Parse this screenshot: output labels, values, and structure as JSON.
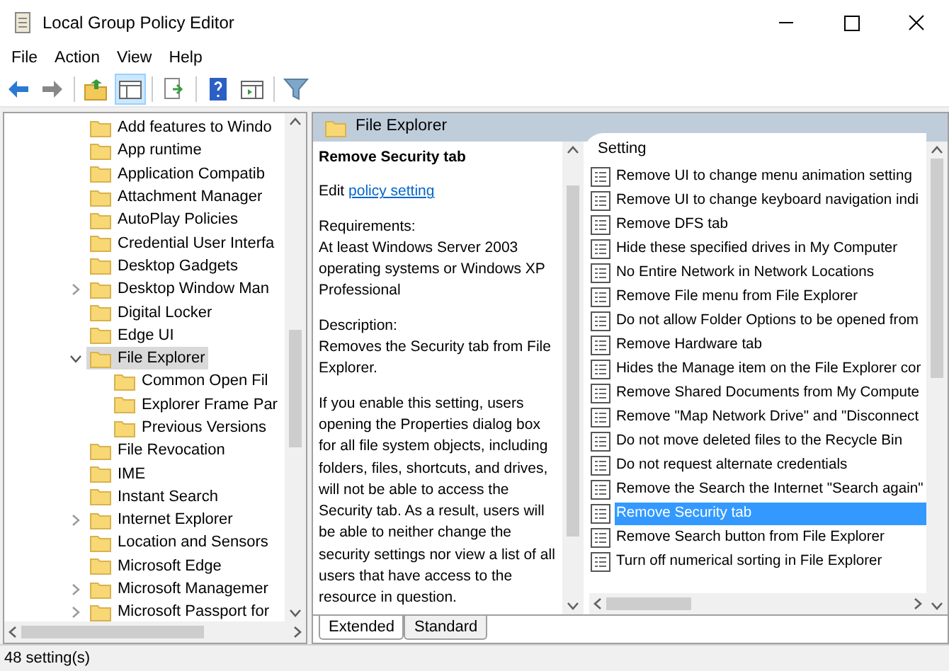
{
  "window": {
    "title": "Local Group Policy Editor"
  },
  "menu": [
    "File",
    "Action",
    "View",
    "Help"
  ],
  "toolbar": [
    {
      "kind": "back",
      "pressed": false
    },
    {
      "kind": "forward",
      "pressed": false
    },
    {
      "kind": "separator"
    },
    {
      "kind": "up",
      "pressed": false
    },
    {
      "kind": "tree",
      "pressed": true
    },
    {
      "kind": "separator"
    },
    {
      "kind": "export",
      "pressed": false
    },
    {
      "kind": "separator"
    },
    {
      "kind": "help",
      "pressed": false
    },
    {
      "kind": "view",
      "pressed": false
    },
    {
      "kind": "separator"
    },
    {
      "kind": "filter",
      "pressed": false
    }
  ],
  "tree": [
    {
      "label": "Add features to Windo",
      "selected": false
    },
    {
      "label": "App runtime",
      "selected": false
    },
    {
      "label": "Application Compatib",
      "selected": false
    },
    {
      "label": "Attachment Manager",
      "selected": false
    },
    {
      "label": "AutoPlay Policies",
      "selected": false
    },
    {
      "label": "Credential User Interfa",
      "selected": false
    },
    {
      "label": "Desktop Gadgets",
      "selected": false
    },
    {
      "label": "Desktop Window Man",
      "selected": false,
      "expanded": false
    },
    {
      "label": "Digital Locker",
      "selected": false
    },
    {
      "label": "Edge UI",
      "selected": false
    },
    {
      "label": "File Explorer",
      "selected": true,
      "expanded": true,
      "children": [
        {
          "label": "Common Open Fil",
          "selected": false
        },
        {
          "label": "Explorer Frame Par",
          "selected": false
        },
        {
          "label": "Previous Versions",
          "selected": false
        }
      ]
    },
    {
      "label": "File Revocation",
      "selected": false
    },
    {
      "label": "IME",
      "selected": false
    },
    {
      "label": "Instant Search",
      "selected": false
    },
    {
      "label": "Internet Explorer",
      "selected": false,
      "expanded": false
    },
    {
      "label": "Location and Sensors",
      "selected": false
    },
    {
      "label": "Microsoft Edge",
      "selected": false
    },
    {
      "label": "Microsoft Managemer",
      "selected": false,
      "expanded": false
    },
    {
      "label": "Microsoft Passport for",
      "selected": false,
      "expanded": false
    }
  ],
  "details": {
    "header": "File Explorer",
    "title": "Remove Security tab",
    "edit_prefix": "Edit",
    "edit_link": "policy setting",
    "sections": [
      {
        "heading": "Requirements:",
        "text": "At least Windows Server 2003 operating systems or Windows XP Professional"
      },
      {
        "heading": "Description:",
        "text": "Removes the Security tab from File Explorer."
      },
      {
        "text": "If you enable this setting, users opening the Properties dialog box for all file system objects, including folders, files, shortcuts, and drives, will not be able to access the Security tab. As a result, users will be able to neither change the security settings nor view a list of all users that have access to the resource in question."
      }
    ]
  },
  "settings": {
    "column": "Setting",
    "rows": [
      {
        "label": "Remove UI to change menu animation setting",
        "selected": false
      },
      {
        "label": "Remove UI to change keyboard navigation indi",
        "selected": false
      },
      {
        "label": "Remove DFS tab",
        "selected": false
      },
      {
        "label": "Hide these specified drives in My Computer",
        "selected": false
      },
      {
        "label": "No Entire Network in Network Locations",
        "selected": false
      },
      {
        "label": "Remove File menu from File Explorer",
        "selected": false
      },
      {
        "label": "Do not allow Folder Options to be opened from",
        "selected": false
      },
      {
        "label": "Remove Hardware tab",
        "selected": false
      },
      {
        "label": "Hides the Manage item on the File Explorer cor",
        "selected": false
      },
      {
        "label": "Remove Shared Documents from My Compute",
        "selected": false
      },
      {
        "label": "Remove \"Map Network Drive\" and \"Disconnect",
        "selected": false
      },
      {
        "label": "Do not move deleted files to the Recycle Bin",
        "selected": false
      },
      {
        "label": "Do not request alternate credentials",
        "selected": false
      },
      {
        "label": "Remove the Search the Internet \"Search again\"",
        "selected": false
      },
      {
        "label": "Remove Security tab",
        "selected": true
      },
      {
        "label": "Remove Search button from File Explorer",
        "selected": false
      },
      {
        "label": "Turn off numerical sorting in File Explorer",
        "selected": false
      }
    ]
  },
  "tabs": [
    {
      "label": "Extended",
      "selected": true
    },
    {
      "label": "Standard",
      "selected": false
    }
  ],
  "status_bar": "48 setting(s)"
}
